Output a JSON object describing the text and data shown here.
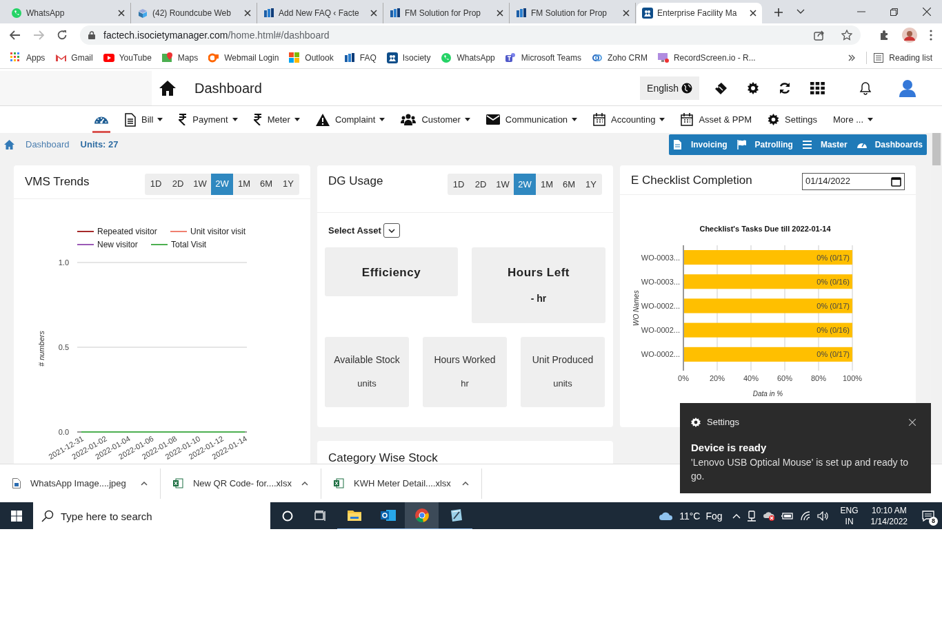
{
  "browser": {
    "tabs": [
      {
        "title": "WhatsApp",
        "kind": "whatsapp",
        "selected": false
      },
      {
        "title": "(42) Roundcube Web",
        "kind": "roundcube",
        "selected": false
      },
      {
        "title": "Add New FAQ ‹ Facte",
        "kind": "fm",
        "selected": false
      },
      {
        "title": "FM Solution for Prop",
        "kind": "fm",
        "selected": false
      },
      {
        "title": "FM Solution for Prop",
        "kind": "fm",
        "selected": false
      },
      {
        "title": "Enterprise Facility Ma",
        "kind": "app",
        "selected": true
      }
    ],
    "address_host": "factech.isocietymanager.com",
    "address_path": "/home.html#/dashboard",
    "bookmarks": [
      {
        "label": "Apps",
        "kind": "apps"
      },
      {
        "label": "Gmail",
        "kind": "gmail"
      },
      {
        "label": "YouTube",
        "kind": "youtube"
      },
      {
        "label": "Maps",
        "kind": "maps"
      },
      {
        "label": "Webmail Login",
        "kind": "webmail"
      },
      {
        "label": "Outlook",
        "kind": "windows"
      },
      {
        "label": "FAQ",
        "kind": "fm"
      },
      {
        "label": "Isociety",
        "kind": "app"
      },
      {
        "label": "WhatsApp",
        "kind": "whatsapp"
      },
      {
        "label": "Microsoft Teams",
        "kind": "teams"
      },
      {
        "label": "Zoho CRM",
        "kind": "zoho"
      },
      {
        "label": "RecordScreen.io - R...",
        "kind": "record"
      }
    ],
    "reading_list": "Reading list"
  },
  "header": {
    "title": "Dashboard",
    "language": "English"
  },
  "nav": [
    {
      "kind": "dashboard",
      "dropdown": false,
      "selected": true
    },
    {
      "label": "Bill",
      "kind": "bill",
      "dropdown": true,
      "selected": false
    },
    {
      "label": "Payment",
      "kind": "rupee",
      "dropdown": true,
      "selected": false
    },
    {
      "label": "Meter",
      "kind": "rupee",
      "dropdown": true,
      "selected": false
    },
    {
      "label": "Complaint",
      "kind": "warning",
      "dropdown": true,
      "selected": false
    },
    {
      "label": "Customer",
      "kind": "users",
      "dropdown": true,
      "selected": false
    },
    {
      "label": "Communication",
      "kind": "mail",
      "dropdown": true,
      "selected": false
    },
    {
      "label": "Accounting",
      "kind": "calendar",
      "dropdown": true,
      "selected": false
    },
    {
      "label": "Asset & PPM",
      "kind": "calendar",
      "dropdown": false,
      "selected": false
    },
    {
      "label": "Settings",
      "kind": "gear",
      "dropdown": false,
      "selected": false
    },
    {
      "label": "More ...",
      "kind": "none",
      "dropdown": true,
      "selected": false
    }
  ],
  "breadcrumb": {
    "link": "Dashboard",
    "current": "Units: 27"
  },
  "quick_buttons": [
    {
      "label": "Invoicing",
      "kind": "doc"
    },
    {
      "label": "Patrolling",
      "kind": "flag"
    },
    {
      "label": "Master",
      "kind": "list"
    },
    {
      "label": "Dashboards",
      "kind": "dashboard"
    }
  ],
  "vms": {
    "title": "VMS Trends",
    "ranges": [
      {
        "label": "1D",
        "selected": false
      },
      {
        "label": "2D",
        "selected": false
      },
      {
        "label": "1W",
        "selected": false
      },
      {
        "label": "2W",
        "selected": true
      },
      {
        "label": "1M",
        "selected": false
      },
      {
        "label": "6M",
        "selected": false
      },
      {
        "label": "1Y",
        "selected": false
      }
    ],
    "chart_data": {
      "type": "line",
      "legend": "top",
      "ylabel": "# numbers",
      "x": [
        "2021-12-31",
        "2022-01-02",
        "2022-01-04",
        "2022-01-06",
        "2022-01-08",
        "2022-01-10",
        "2022-01-12",
        "2022-01-14"
      ],
      "ylim": [
        0,
        1
      ],
      "yticks": [
        {
          "value": 0,
          "label": "0.0"
        },
        {
          "value": 0.5,
          "label": "0.5"
        },
        {
          "value": 1,
          "label": "1.0"
        }
      ],
      "series": [
        {
          "name": "Repeated visitor",
          "color": "#a52a2a",
          "values": [
            null,
            null,
            null,
            null,
            null,
            null,
            null,
            null
          ]
        },
        {
          "name": "Unit visitor visit",
          "color": "#f08070",
          "values": [
            null,
            null,
            null,
            null,
            null,
            null,
            null,
            null
          ]
        },
        {
          "name": "New visitor",
          "color": "#9b59b6",
          "values": [
            null,
            null,
            null,
            null,
            null,
            null,
            null,
            null
          ]
        },
        {
          "name": "Total Visit",
          "color": "#4caf50",
          "values": [
            0,
            0,
            0,
            0,
            0,
            0,
            0,
            0
          ]
        }
      ]
    }
  },
  "dg": {
    "title": "DG Usage",
    "ranges": [
      {
        "label": "1D",
        "selected": false
      },
      {
        "label": "2D",
        "selected": false
      },
      {
        "label": "1W",
        "selected": false
      },
      {
        "label": "2W",
        "selected": true
      },
      {
        "label": "1M",
        "selected": false
      },
      {
        "label": "6M",
        "selected": false
      },
      {
        "label": "1Y",
        "selected": false
      }
    ],
    "select_label": "Select Asset",
    "tiles": [
      {
        "title": "Efficiency",
        "kind": "big"
      },
      {
        "title": "Hours Left",
        "value": "- hr",
        "kind": "big"
      },
      {
        "title": "Available Stock",
        "value": "units",
        "kind": "small"
      },
      {
        "title": "Hours Worked",
        "value": "hr",
        "kind": "small"
      },
      {
        "title": "Unit Produced",
        "value": "units",
        "kind": "small"
      }
    ]
  },
  "category_card": {
    "title": "Category Wise Stock"
  },
  "checklist": {
    "title": "E Checklist Completion",
    "date": "01/14/2022",
    "chart_data": {
      "type": "bar",
      "orientation": "horizontal",
      "title": "Checklist's Tasks Due till 2022-01-14",
      "xlabel": "Data in %",
      "ylabel": "WO Names",
      "categories": [
        "WO-0003...",
        "WO-0003...",
        "WO-0002...",
        "WO-0002...",
        "WO-0002..."
      ],
      "series": [
        {
          "color": "#ffbf00",
          "values": [
            100,
            100,
            100,
            100,
            100
          ]
        }
      ],
      "xlim": [
        0,
        100
      ],
      "grid": true,
      "xticks": [
        {
          "value": 0,
          "label": "0%"
        },
        {
          "value": 20,
          "label": "20%"
        },
        {
          "value": 40,
          "label": "40%"
        },
        {
          "value": 60,
          "label": "60%"
        },
        {
          "value": 80,
          "label": "80%"
        },
        {
          "value": 100,
          "label": "100%"
        }
      ],
      "value_labels": [
        "0% (0/17)",
        "0% (0/16)",
        "0% (0/17)",
        "0% (0/16)",
        "0% (0/17)"
      ]
    }
  },
  "downloads": [
    {
      "name": "WhatsApp Image....jpeg",
      "kind": "image"
    },
    {
      "name": "New QR Code- for....xlsx",
      "kind": "excel"
    },
    {
      "name": "KWH Meter Detail....xlsx",
      "kind": "excel"
    }
  ],
  "toast": {
    "app": "Settings",
    "title": "Device is ready",
    "body": "'Lenovo USB Optical Mouse' is set up and ready to go."
  },
  "taskbar": {
    "search_placeholder": "Type here to search",
    "apps": [
      {
        "kind": "explorer",
        "selected": false
      },
      {
        "kind": "outlook",
        "selected": false
      },
      {
        "kind": "chrome",
        "selected": true
      },
      {
        "kind": "pen",
        "selected": false
      }
    ],
    "temperature": "11°C",
    "weather": "Fog",
    "language": "ENG",
    "region": "IN",
    "time": "10:10 AM",
    "date": "1/14/2022",
    "notifications": "8"
  }
}
